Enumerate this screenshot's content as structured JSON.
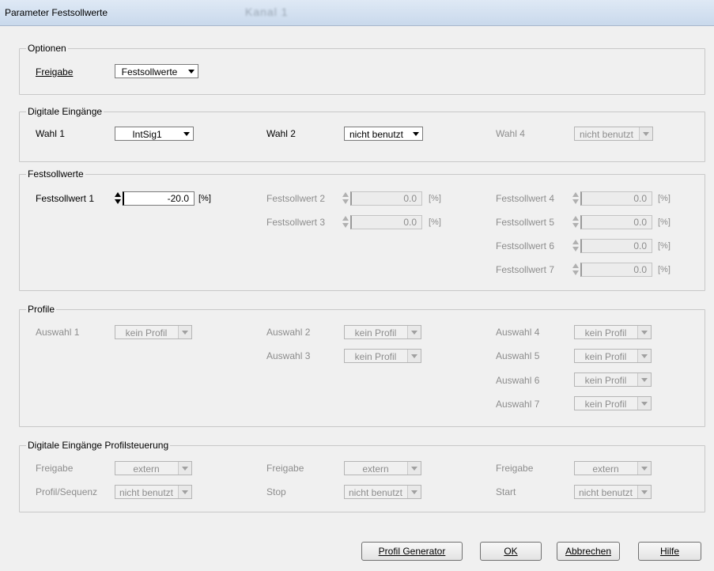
{
  "window": {
    "title": "Parameter Festsollwerte",
    "blurred_subtitle": "Kanal 1"
  },
  "optionen": {
    "legend": "Optionen",
    "freigabe_label": "Freigabe",
    "freigabe_value": "Festsollwerte"
  },
  "digitale": {
    "legend": "Digitale Eingänge",
    "wahl1_label": "Wahl 1",
    "wahl1_value": "IntSig1",
    "wahl2_label": "Wahl 2",
    "wahl2_value": "nicht benutzt",
    "wahl4_label": "Wahl 4",
    "wahl4_value": "nicht benutzt"
  },
  "festsollwerte": {
    "legend": "Festsollwerte",
    "unit": "[%]",
    "items": [
      {
        "label": "Festsollwert 1",
        "value": "-20.0"
      },
      {
        "label": "Festsollwert 2",
        "value": "0.0"
      },
      {
        "label": "Festsollwert 3",
        "value": "0.0"
      },
      {
        "label": "Festsollwert 4",
        "value": "0.0"
      },
      {
        "label": "Festsollwert 5",
        "value": "0.0"
      },
      {
        "label": "Festsollwert 6",
        "value": "0.0"
      },
      {
        "label": "Festsollwert 7",
        "value": "0.0"
      }
    ]
  },
  "profile": {
    "legend": "Profile",
    "items": [
      {
        "label": "Auswahl 1",
        "value": "kein Profil"
      },
      {
        "label": "Auswahl 2",
        "value": "kein Profil"
      },
      {
        "label": "Auswahl 3",
        "value": "kein Profil"
      },
      {
        "label": "Auswahl 4",
        "value": "kein Profil"
      },
      {
        "label": "Auswahl 5",
        "value": "kein Profil"
      },
      {
        "label": "Auswahl 6",
        "value": "kein Profil"
      },
      {
        "label": "Auswahl 7",
        "value": "kein Profil"
      }
    ]
  },
  "profilsteuerung": {
    "legend": "Digitale Eingänge Profilsteuerung",
    "items": [
      {
        "label": "Freigabe",
        "value": "extern"
      },
      {
        "label": "Profil/Sequenz",
        "value": "nicht benutzt"
      },
      {
        "label": "Freigabe",
        "value": "extern"
      },
      {
        "label": "Stop",
        "value": "nicht benutzt"
      },
      {
        "label": "Freigabe",
        "value": "extern"
      },
      {
        "label": "Start",
        "value": "nicht benutzt"
      }
    ]
  },
  "buttons": {
    "profil_generator": "Profil Generator",
    "ok": "OK",
    "abbrechen": "Abbrechen",
    "hilfe": "Hilfe"
  }
}
